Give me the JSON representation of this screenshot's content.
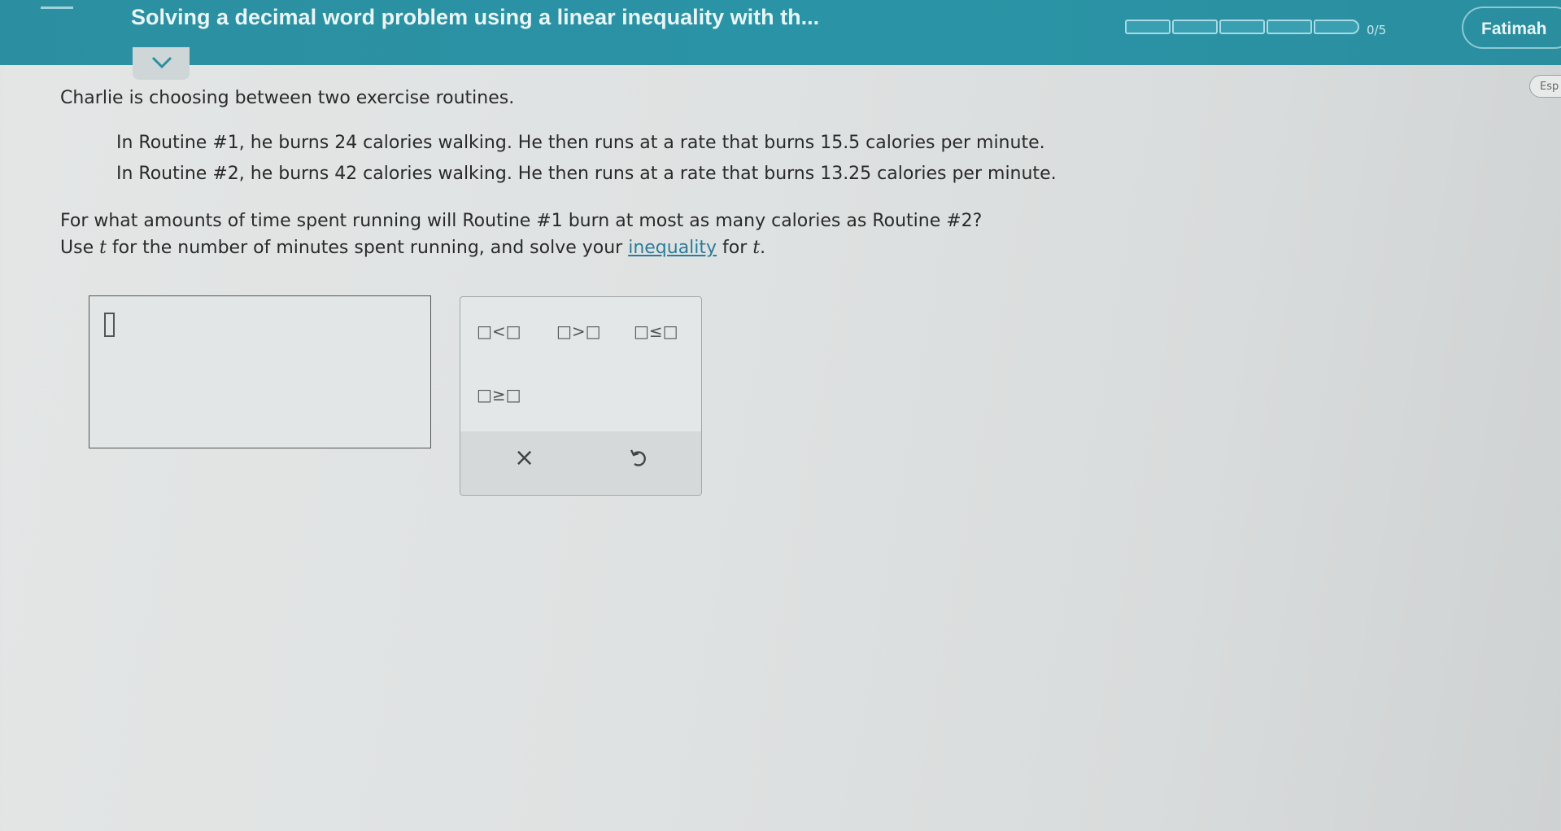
{
  "header": {
    "title": "Solving a decimal word problem using a linear inequality with th...",
    "progress_text": "0/5",
    "user_name": "Fatimah"
  },
  "language_button": "Esp",
  "problem": {
    "intro": "Charlie is choosing between two exercise routines.",
    "routine1": "In Routine #1, he burns 24 calories walking. He then runs at a rate that burns 15.5 calories per minute.",
    "routine2": "In Routine #2, he burns 42 calories walking. He then runs at a rate that burns 13.25 calories per minute.",
    "question": "For what amounts of time spent running will Routine #1 burn at most as many calories as Routine #2?",
    "instruction_prefix": "Use ",
    "variable": "t",
    "instruction_middle": " for the number of minutes spent running, and solve your ",
    "instruction_link": "inequality",
    "instruction_suffix": " for ",
    "instruction_end": "."
  },
  "keypad": {
    "less_than": "□<□",
    "greater_than": "□>□",
    "less_equal": "□≤□",
    "greater_equal": "□≥□",
    "clear": "×"
  },
  "colors": {
    "header": "#2b8fa1",
    "link": "#2a7c99"
  }
}
